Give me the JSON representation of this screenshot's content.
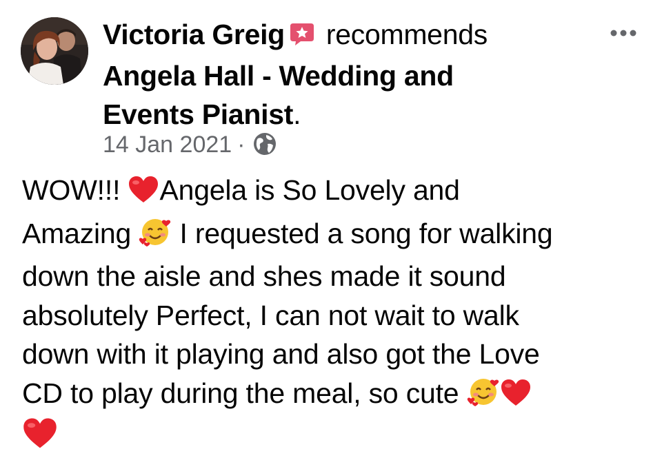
{
  "post": {
    "author_name": "Victoria Greig",
    "action_text": "recommends",
    "page_name_line1": "Angela Hall - Wedding and",
    "page_name_line2": "Events Pianist",
    "period": ".",
    "date": "14 Jan 2021",
    "separator": "·",
    "privacy_icon": "globe-icon",
    "badge_icon": "recommendation-star-icon",
    "more_icon": "more-options-icon",
    "body_lines": [
      {
        "before": "WOW!!! ",
        "emoji": "red-heart-emoji",
        "after": "Angela is So Lovely and"
      },
      {
        "before": "Amazing ",
        "emoji": "smiling-face-with-hearts-emoji",
        "after": " I requested a song for walking"
      },
      {
        "text": "down the aisle and shes made it sound"
      },
      {
        "text": "absolutely Perfect, I can not wait to walk"
      },
      {
        "text": "down with it playing and also got the Love"
      },
      {
        "before": "CD to play during the meal, so cute ",
        "emoji": "smiling-face-with-hearts-emoji",
        "emoji2": "red-heart-emoji"
      },
      {
        "emoji": "red-heart-emoji"
      }
    ]
  },
  "colors": {
    "text": "#050505",
    "meta_text": "#65676b",
    "badge": "#e4506e",
    "heart": "#e8222d",
    "emoji_face": "#f7c531"
  }
}
